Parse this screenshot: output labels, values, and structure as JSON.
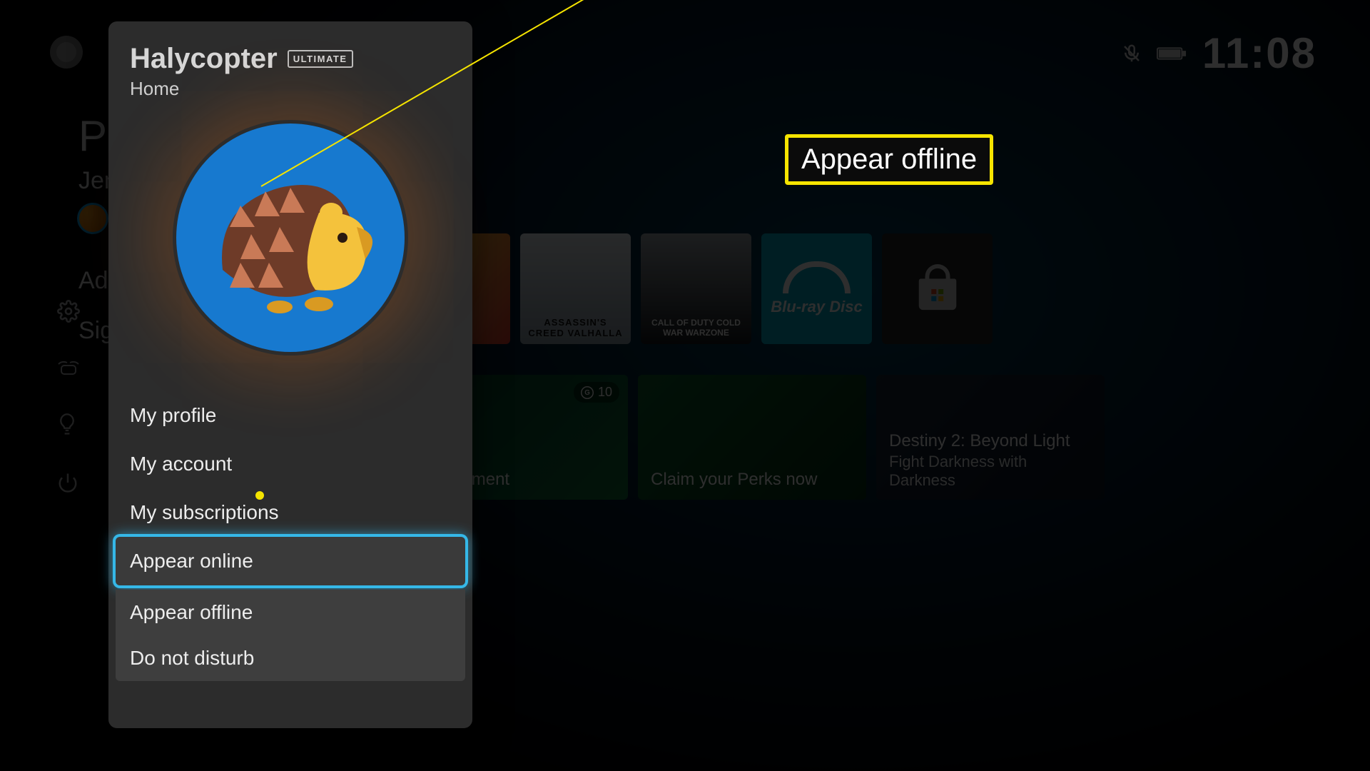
{
  "header": {
    "clock": "11:08",
    "mic_muted": true,
    "battery_level": "full"
  },
  "background": {
    "heading_fragment": "Pro",
    "row_user_fragment": "Jen",
    "row_add_fragment": "Ad",
    "row_sign_fragment": "Sigr",
    "tiles": {
      "row1": [
        {
          "name": "streetfighter",
          "title": ""
        },
        {
          "name": "ac-valhalla",
          "title": "ASSASSIN'S CREED VALHALLA"
        },
        {
          "name": "cod-coldwar",
          "title": "CALL OF DUTY COLD WAR WARZONE"
        },
        {
          "name": "bluray",
          "title": "Blu-ray Disc"
        },
        {
          "name": "store",
          "title": ""
        }
      ],
      "row2": [
        {
          "name": "achievement",
          "label": "achievement",
          "badge": "10"
        },
        {
          "name": "perks",
          "label": "Claim your Perks now"
        },
        {
          "name": "destiny2",
          "label": "Destiny 2: Beyond Light",
          "sub": "Fight Darkness with Darkness"
        }
      ]
    }
  },
  "popover": {
    "gamertag": "Halycopter",
    "tier_badge": "ULTIMATE",
    "location_label": "Home",
    "menu": [
      {
        "id": "profile",
        "label": "My profile"
      },
      {
        "id": "account",
        "label": "My account"
      },
      {
        "id": "subs",
        "label": "My subscriptions"
      }
    ],
    "presence_selected": "Appear online",
    "presence_options": [
      {
        "id": "offline",
        "label": "Appear offline"
      },
      {
        "id": "dnd",
        "label": "Do not disturb"
      }
    ]
  },
  "annotation": {
    "label": "Appear offline"
  }
}
